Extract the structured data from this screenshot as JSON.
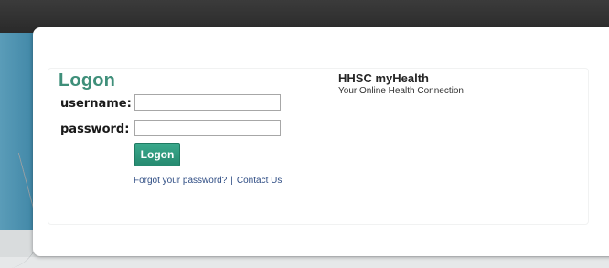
{
  "logon_form": {
    "title": "Logon",
    "username_label": "username:",
    "username_value": "",
    "password_label": "password:",
    "password_value": "",
    "submit_label": "Logon",
    "forgot_password_link": "Forgot your password?",
    "separator": "|",
    "contact_link": "Contact Us"
  },
  "brand": {
    "title": "HHSC myHealth",
    "subtitle": "Your Online Health Connection"
  },
  "colors": {
    "accent": "#3f8f7a",
    "button": "#268a70",
    "link": "#2f4d84",
    "top_bar": "#2a2a2a",
    "side_band": "#3f86a6"
  }
}
